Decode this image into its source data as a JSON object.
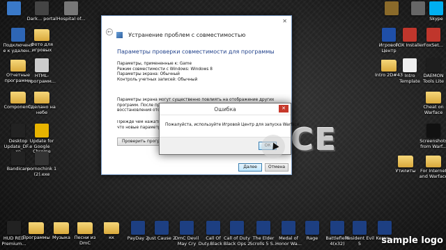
{
  "desktop_icons": [
    {
      "label": "",
      "img_color": "#3a79c8",
      "folder": false
    },
    {
      "label": "Dark... portal",
      "img_color": "#444",
      "folder": false
    },
    {
      "label": "Hospital of...",
      "img_color": "#777",
      "folder": false
    },
    {
      "label": "",
      "img_color": "#8a6a2a",
      "folder": false
    },
    {
      "label": "",
      "img_color": "#666",
      "folder": false
    },
    {
      "label": "Skype",
      "img_color": "#00aff0",
      "folder": false
    },
    {
      "label": "Подключение к удален...",
      "img_color": "#2e66b5",
      "folder": false
    },
    {
      "label": "Фото для игровых",
      "img_color": "",
      "folder": true
    },
    {
      "label": "Игровой Центр",
      "img_color": "#1f4fa8",
      "folder": false
    },
    {
      "label": "FOX Installer",
      "img_color": "#c0362c",
      "folder": false
    },
    {
      "label": "FoxSet...",
      "img_color": "#c0362c",
      "folder": false
    },
    {
      "label": "Отчетные программы",
      "img_color": "",
      "folder": true
    },
    {
      "label": "HTML-программ...",
      "img_color": "#cccccc",
      "folder": false
    },
    {
      "label": "Intro 2D#43",
      "img_color": "",
      "folder": true
    },
    {
      "label": "Intro Template",
      "img_color": "#eee",
      "folder": false
    },
    {
      "label": "DAEMON Tools Lite",
      "img_color": "#1e1e1e",
      "folder": false
    },
    {
      "label": "Components",
      "img_color": "",
      "folder": true
    },
    {
      "label": "Сделано на небе",
      "img_color": "",
      "folder": true
    },
    {
      "label": "Cheat on Warface",
      "img_color": "",
      "folder": true
    },
    {
      "label": "Desktop Update_DF.exe",
      "img_color": "#222",
      "folder": false
    },
    {
      "label": "Update for Google Chrome",
      "img_color": "#e8b400",
      "folder": false
    },
    {
      "label": "Screenshots from Warf...",
      "img_color": "#111",
      "folder": false
    },
    {
      "label": "Bandicam",
      "img_color": "#222",
      "folder": false
    },
    {
      "label": "pornochink 1 (2).exe",
      "img_color": "#333",
      "folder": false
    },
    {
      "label": "Утилиты",
      "img_color": "",
      "folder": true
    },
    {
      "label": "For Internet and Warface",
      "img_color": "",
      "folder": true
    },
    {
      "label": "HUD RED Premium...",
      "img_color": "#222",
      "folder": false
    },
    {
      "label": "Программы",
      "img_color": "",
      "folder": true
    },
    {
      "label": "Музыка",
      "img_color": "",
      "folder": true
    },
    {
      "label": "Песни из DmC",
      "img_color": "",
      "folder": true
    },
    {
      "label": "кк",
      "img_color": "",
      "folder": true
    },
    {
      "label": "PayDay 2",
      "img_color": "#1d3f82",
      "folder": false
    },
    {
      "label": "Just Cause 2",
      "img_color": "#1d3f82",
      "folder": false
    },
    {
      "label": "DmC Devil May Cry",
      "img_color": "#1d3f82",
      "folder": false
    },
    {
      "label": "Call Of Duty.Black ...",
      "img_color": "#1d3f82",
      "folder": false
    },
    {
      "label": "Call of Duty Black Ops 2",
      "img_color": "#1d3f82",
      "folder": false
    },
    {
      "label": "The Elder Scrolls 5 S...",
      "img_color": "#1d3f82",
      "folder": false
    },
    {
      "label": "Medal of Honor Wa...",
      "img_color": "#1d3f82",
      "folder": false
    },
    {
      "label": "Rage",
      "img_color": "#1d3f82",
      "folder": false
    },
    {
      "label": "Battlefield 4(x32)",
      "img_color": "#1d3f82",
      "folder": false
    },
    {
      "label": "Resident Evil 5",
      "img_color": "#1d3f82",
      "folder": false
    },
    {
      "label": "Keran...",
      "img_color": "#1d3f82",
      "folder": false
    }
  ],
  "wallpaper_text": "CE",
  "compat_dialog": {
    "title": "Устранение проблем с совместимостью",
    "section_title": "Параметры проверки совместимости для программы",
    "params": [
      "Параметры, примененные к: Game",
      "Режим совместимости с Windows: Windows 8",
      "Параметры экрана: Обычный",
      "Контроль учетных записей: Обычный"
    ],
    "note": "Параметры экрана могут существенно повлиять на отображение других программ. После проверки программы необходимо закрыть ее для восстановления отображения.",
    "prelude_lines": [
      "Прежде чем нажать кн",
      "что новые параметры у"
    ],
    "test_button": "Проверить программ",
    "next_button": "Далее",
    "cancel_button": "Отмена"
  },
  "error_dialog": {
    "title": "Ошибка",
    "close_glyph": "✕",
    "message": "Пожалуйста, используйте Игровой Центр для запуска Warface.",
    "ok_button": "ОК"
  },
  "watermark": "sample logo"
}
